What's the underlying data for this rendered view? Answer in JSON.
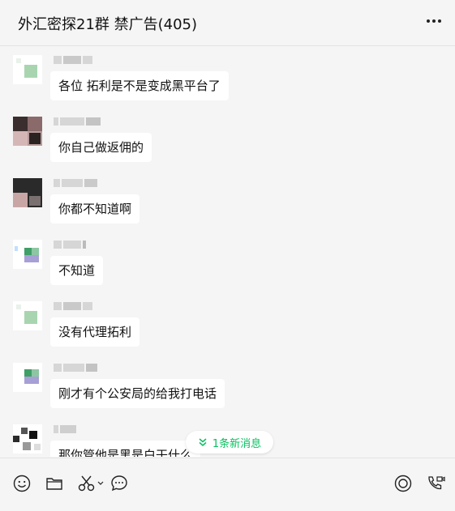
{
  "header": {
    "title": "外汇密探21群 禁广告(405)",
    "more_icon": "more-horizontal-icon"
  },
  "messages": [
    {
      "text": "各位  拓利是不是变成黑平台了"
    },
    {
      "text": "你自己做返佣的"
    },
    {
      "text": "你都不知道啊"
    },
    {
      "text": "不知道"
    },
    {
      "text": "没有代理拓利"
    },
    {
      "text": "刚才有个公安局的给我打电话"
    },
    {
      "text": "那你管他是黑是白干什么"
    }
  ],
  "new_message_toast": {
    "label": "1条新消息",
    "icon": "double-chevron-down-icon",
    "color": "#07c160"
  },
  "toolbar": {
    "left_icons": [
      "emoji-icon",
      "folder-icon",
      "scissors-icon",
      "chat-bubble-icon"
    ],
    "right_icons": [
      "live-icon",
      "phone-video-icon"
    ]
  }
}
